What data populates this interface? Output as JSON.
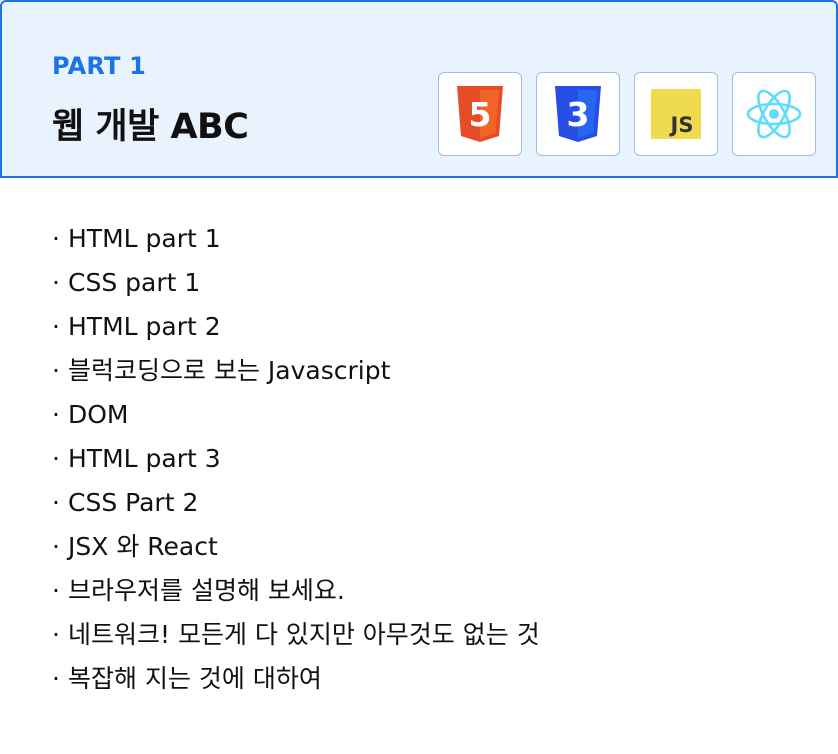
{
  "header": {
    "part_label": "PART 1",
    "title": "웹 개발 ABC",
    "background": "#e8f3fe",
    "border_color": "#1a73e8",
    "icons": [
      {
        "name": "html5-icon",
        "text": "5",
        "color": "#e44d26"
      },
      {
        "name": "css3-icon",
        "text": "3",
        "color": "#264de4"
      },
      {
        "name": "javascript-icon",
        "text": "JS",
        "color": "#f0db4f"
      },
      {
        "name": "react-icon",
        "color": "#61dafb"
      }
    ]
  },
  "topics": {
    "bullet": "·",
    "items": [
      "HTML part 1",
      "CSS part 1",
      "HTML part 2",
      "블럭코딩으로 보는 Javascript",
      "DOM",
      "HTML part 3",
      "CSS Part 2",
      "JSX 와 React",
      "브라우저를 설명해 보세요.",
      "네트워크! 모든게 다 있지만 아무것도 없는 것",
      "복잡해 지는 것에 대하여"
    ]
  }
}
